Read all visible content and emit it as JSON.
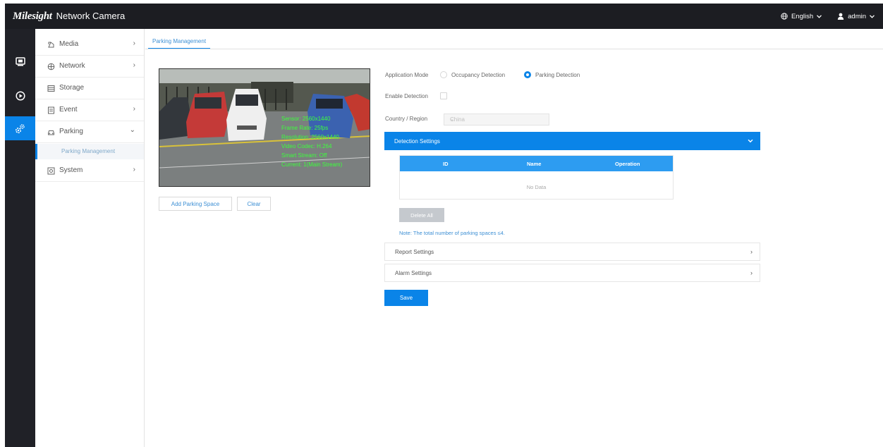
{
  "header": {
    "logo_text": "Milesight",
    "product_name": "Network Camera",
    "language_label": "English",
    "user_label": "admin"
  },
  "rail": {
    "icons": [
      "monitor-icon",
      "playback-icon",
      "settings-icon"
    ],
    "active_color": "#0a84e8"
  },
  "menu": {
    "items": [
      {
        "label": "Media",
        "icon": "media-icon",
        "expanded": false
      },
      {
        "label": "Network",
        "icon": "network-icon",
        "expanded": false
      },
      {
        "label": "Storage",
        "icon": "storage-icon",
        "expanded": false
      },
      {
        "label": "Event",
        "icon": "event-icon",
        "expanded": false
      },
      {
        "label": "Parking",
        "icon": "parking-icon",
        "expanded": true
      },
      {
        "label": "System",
        "icon": "system-icon",
        "expanded": false
      }
    ],
    "submenu": {
      "label": "Parking Management"
    }
  },
  "main": {
    "tab_label": "Parking Management",
    "video": {
      "osd_lines": [
        "Sensor: 2560x1440",
        "Frame Rate: 25fps",
        "Resolution: 2560x1440",
        "Video Codec: H.264",
        "Smart Stream: Off",
        "Current: 1(Main Stream)"
      ]
    },
    "add_parking_space_label": "Add Parking Space",
    "clear_label": "Clear",
    "application_mode_label": "Application Mode",
    "occupancy_detection_label": "Occupancy Detection",
    "parking_detection_label": "Parking Detection",
    "selected_mode": "Parking Detection",
    "enable_detection_label": "Enable Detection",
    "country_region_label": "Country / Region",
    "country_region_value": "China",
    "detection_settings_label": "Detection Settings",
    "table": {
      "columns": [
        "ID",
        "Name",
        "Operation"
      ],
      "empty_text": "No Data"
    },
    "delete_all_label": "Delete All",
    "note_text": "Note: The total number of parking spaces ≤4.",
    "report_settings_label": "Report Settings",
    "alarm_settings_label": "Alarm Settings",
    "save_label": "Save"
  }
}
